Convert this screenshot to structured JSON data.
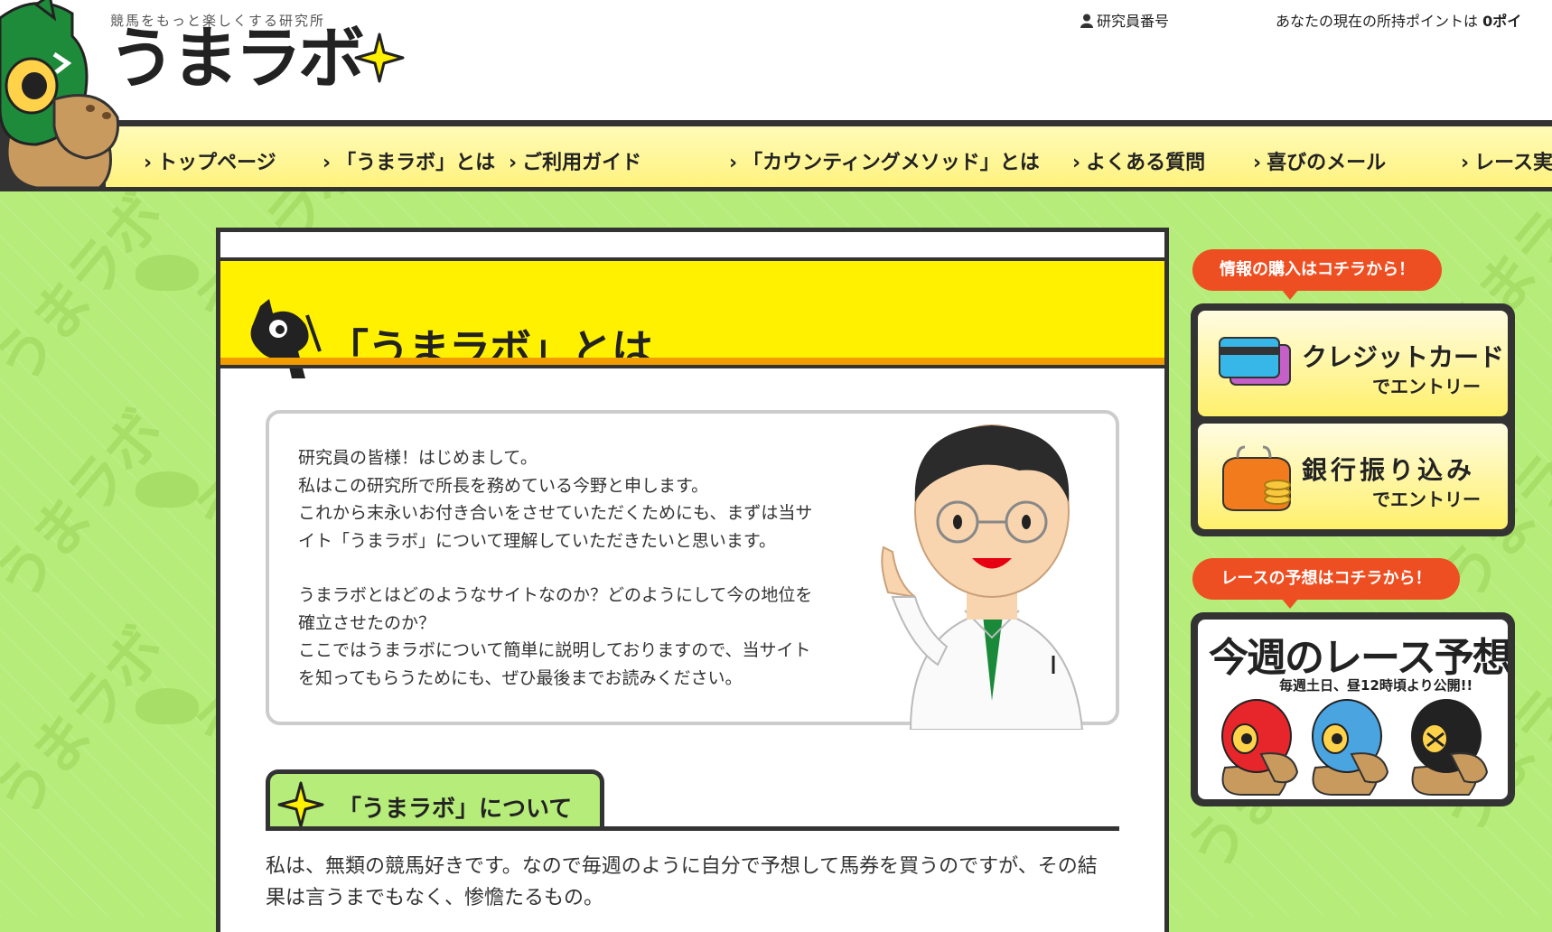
{
  "header": {
    "tagline": "競馬をもっと楽しくする研究所",
    "logo_text": "うまラボ",
    "researcher_label": "研究員番号",
    "points_label": "あなたの現在の所持ポイントは",
    "points_value": "0ポイ"
  },
  "nav": {
    "items": [
      {
        "label": "トップページ"
      },
      {
        "label": "「うまラボ」とは"
      },
      {
        "label": "ご利用ガイド"
      },
      {
        "label": "「カウンティングメソッド」とは"
      },
      {
        "label": "よくある質問"
      },
      {
        "label": "喜びのメール"
      },
      {
        "label": "レース実"
      }
    ]
  },
  "main": {
    "page_title": "「うまラボ」とは",
    "intro_paragraphs": [
      [
        "研究員の皆様！はじめまして。",
        "私はこの研究所で所長を務めている今野と申します。",
        "これから末永いお付き合いをさせていただくためにも、まずは当サ",
        "イト「うまラボ」について理解していただきたいと思います。"
      ],
      [
        "うまラボとはどのようなサイトなのか？どのようにして今の地位を",
        "確立させたのか？",
        "ここではうまラボについて簡単に説明しておりますので、当サイト",
        "を知ってもらうためにも、ぜひ最後までお読みください。"
      ]
    ],
    "section_title": "「うまラボ」について",
    "body_lines": [
      "私は、無類の競馬好きです。なので毎週のように自分で予想して馬券を買うのですが、その結",
      "果は言うまでもなく、惨憺たるもの。"
    ]
  },
  "sidebar": {
    "purchase_bubble": "情報の購入はコチラから！",
    "credit_main": "クレジットカード",
    "credit_sub": "でエントリー",
    "bank_main": "銀行振り込み",
    "bank_sub": "でエントリー",
    "race_bubble": "レースの予想はコチラから！",
    "race_title": "今週のレース予想",
    "race_sub": "毎週土日、昼12時頃より公開!!"
  },
  "bg_words": [
    "うまラボ"
  ],
  "colors": {
    "bg_green": "#b6ec79",
    "nav_yellow": "#fff27e",
    "title_yellow": "#fff100",
    "orange": "#f39c00",
    "bubble_red": "#ee4f22"
  }
}
